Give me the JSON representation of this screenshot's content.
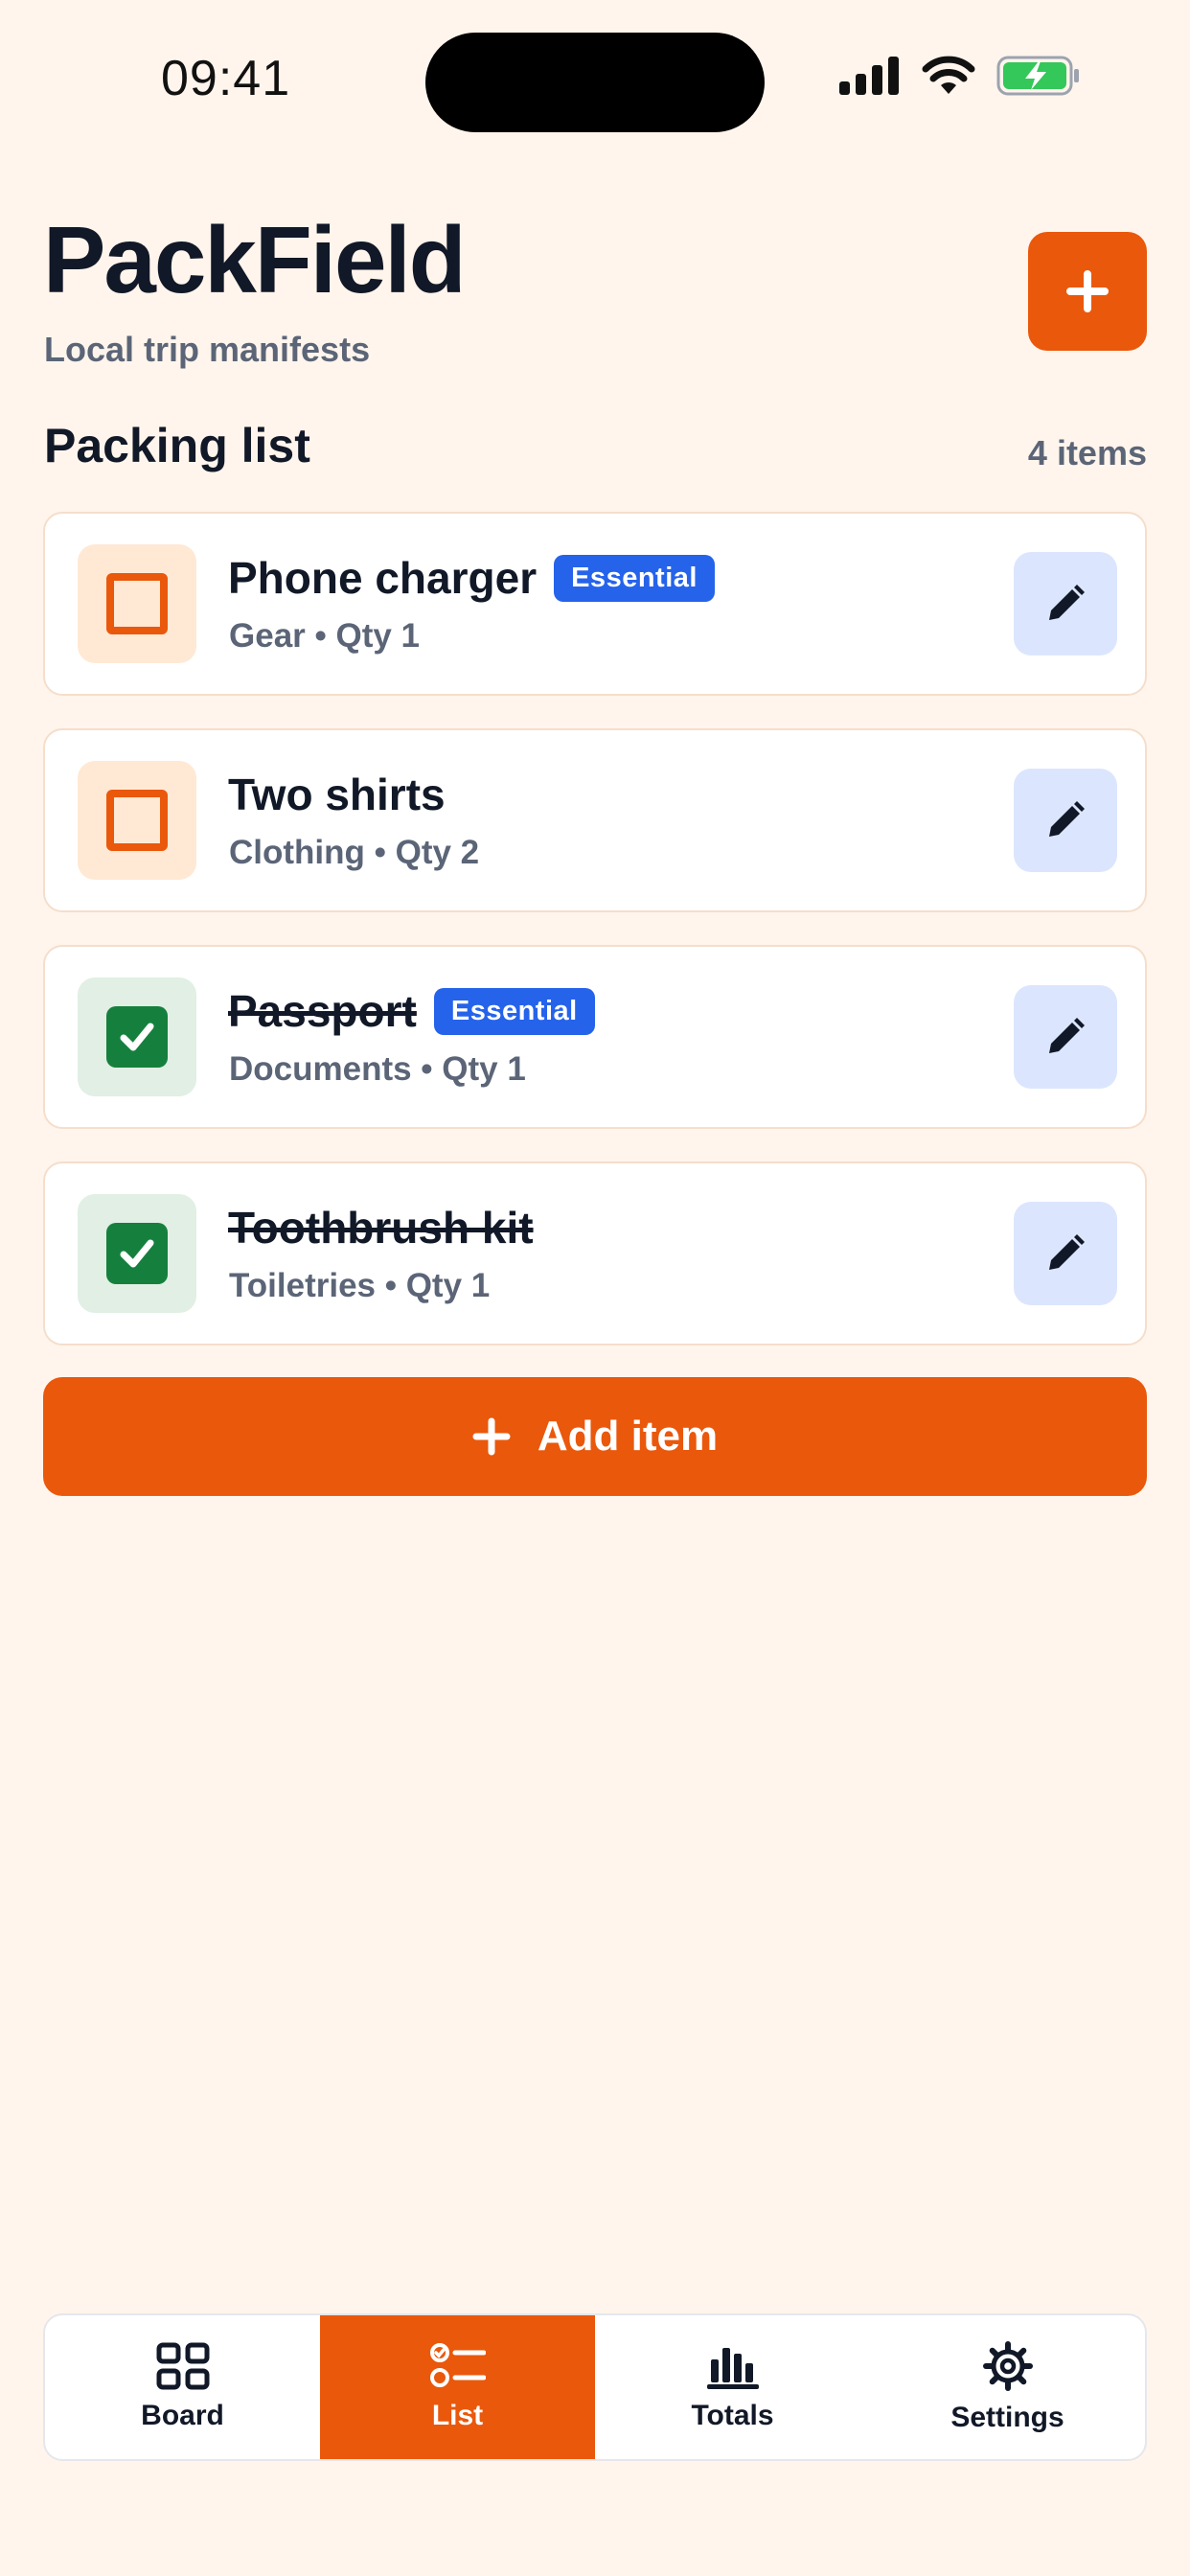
{
  "status_bar": {
    "time": "09:41"
  },
  "header": {
    "title": "PackField",
    "subtitle": "Local trip manifests",
    "add_icon": "plus-icon"
  },
  "section": {
    "title": "Packing list",
    "count": "4 items"
  },
  "items": [
    {
      "name": "Phone charger",
      "badge": "Essential",
      "meta": "Gear • Qty 1",
      "checked": false
    },
    {
      "name": "Two shirts",
      "badge": "",
      "meta": "Clothing • Qty 2",
      "checked": false
    },
    {
      "name": "Passport",
      "badge": "Essential",
      "meta": "Documents • Qty 1",
      "checked": true
    },
    {
      "name": "Toothbrush kit",
      "badge": "",
      "meta": "Toiletries • Qty 1",
      "checked": true
    }
  ],
  "add_item": {
    "label": "Add item"
  },
  "tabs": [
    {
      "label": "Board",
      "icon": "grid-icon",
      "active": false
    },
    {
      "label": "List",
      "icon": "checklist-icon",
      "active": true
    },
    {
      "label": "Totals",
      "icon": "bar-chart-icon",
      "active": false
    },
    {
      "label": "Settings",
      "icon": "gear-icon",
      "active": false
    }
  ],
  "colors": {
    "background": "#FFF5EC",
    "accent": "#EA580C",
    "badge": "#2563EB",
    "checked": "#15803D",
    "edit_button_bg": "#DBE6FE"
  }
}
